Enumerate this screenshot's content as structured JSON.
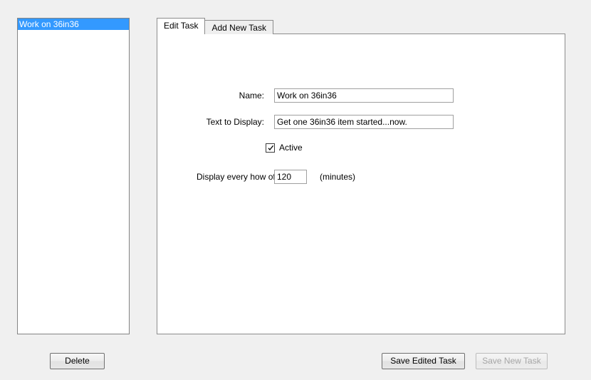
{
  "task_list": {
    "name": "task-list",
    "items": [
      {
        "label": "Work on 36in36",
        "selected": true
      }
    ]
  },
  "tabs": [
    {
      "id": "edit-task",
      "label": "Edit Task",
      "active": true
    },
    {
      "id": "add-new-task",
      "label": "Add New Task",
      "active": false
    }
  ],
  "form": {
    "name": {
      "label": "Name:",
      "value": "Work on 36in36",
      "placeholder": ""
    },
    "text_to_display": {
      "label": "Text to Display:",
      "value": "Get one 36in36 item started...now.",
      "placeholder": ""
    },
    "active": {
      "label": "Active",
      "checked": true,
      "checkmark_icon": "check-icon"
    },
    "interval": {
      "label": "Display every how often:",
      "value": "120",
      "placeholder": "",
      "units": "(minutes)"
    }
  },
  "buttons": {
    "delete": {
      "label": "Delete",
      "enabled": true
    },
    "save_edited": {
      "label": "Save Edited Task",
      "enabled": true
    },
    "save_new": {
      "label": "Save New Task",
      "enabled": false
    }
  },
  "colors": {
    "window_background": "#f0f0f0",
    "panel_background": "#ffffff",
    "selection": "#3399ff",
    "selection_text": "#ffffff",
    "border": "#8c8c8c",
    "disabled_text": "#a6a6a6"
  }
}
